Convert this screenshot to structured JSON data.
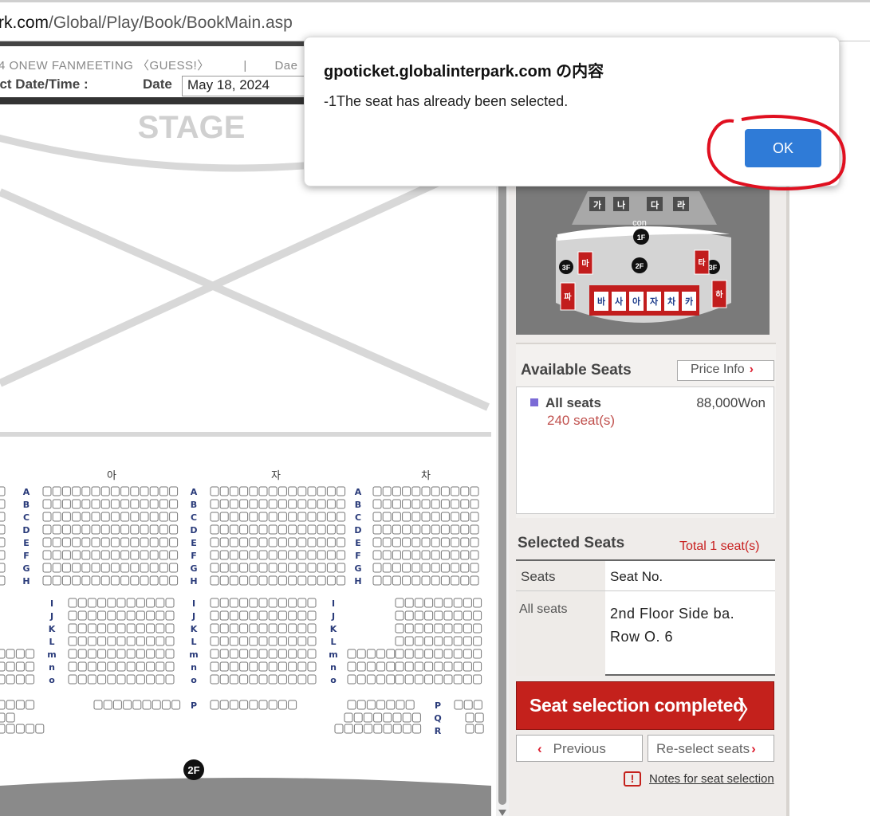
{
  "browser": {
    "url_prefix": "rk.com",
    "url_path": "/Global/Play/Book/BookMain.asp"
  },
  "booking": {
    "event_title": "4 ONEW FANMEETING 〈GUESS!〉",
    "separator": "|",
    "venue_fragment": "Dae",
    "select_label": "ect Date/Time :",
    "date_label": "Date",
    "date_value": "May 18, 2024"
  },
  "seat_map": {
    "stage_label": "STAGE",
    "sections": [
      "아",
      "자",
      "차"
    ],
    "rows_upper": [
      "A",
      "B",
      "C",
      "D",
      "E",
      "F",
      "G",
      "H"
    ],
    "rows_middle": [
      "I",
      "J",
      "K",
      "L",
      "m",
      "n",
      "o"
    ],
    "row_p": "P",
    "rows_right_bottom": [
      "P",
      "Q",
      "R"
    ],
    "floor_badge": "2F"
  },
  "mini_map": {
    "top_sections": [
      "가",
      "나",
      "다",
      "라"
    ],
    "con_label": "con",
    "floor_1": "1F",
    "floor_2": "2F",
    "floor_3": "3F",
    "side_left": [
      "마",
      "파"
    ],
    "side_right": [
      "타",
      "하"
    ],
    "bottom_sections": [
      "바",
      "사",
      "아",
      "자",
      "차",
      "카"
    ]
  },
  "available": {
    "title": "Available Seats",
    "price_info_label": "Price Info",
    "grade_name": "All seats",
    "grade_price": "88,000Won",
    "grade_count": "240 seat(s)",
    "grade_color": "#7b6bd6"
  },
  "selected": {
    "title": "Selected Seats",
    "total": "Total 1 seat(s)",
    "col_seats": "Seats",
    "col_seat_no": "Seat No.",
    "row_grade": "All seats",
    "row_location": "2nd Floor Side ba.",
    "row_seat": "Row O. 6"
  },
  "actions": {
    "complete_label": "Seat selection completed",
    "previous_label": "Previous",
    "reselect_label": "Re-select seats",
    "notes_label": "Notes for seat selection"
  },
  "dialog": {
    "title": "gpoticket.globalinterpark.com の内容",
    "message": "-1The seat has already been selected.",
    "ok_label": "OK",
    "ok_color": "#2f7bd7"
  },
  "colors": {
    "accent_red": "#c4211c",
    "annotation_red": "#e01020"
  }
}
